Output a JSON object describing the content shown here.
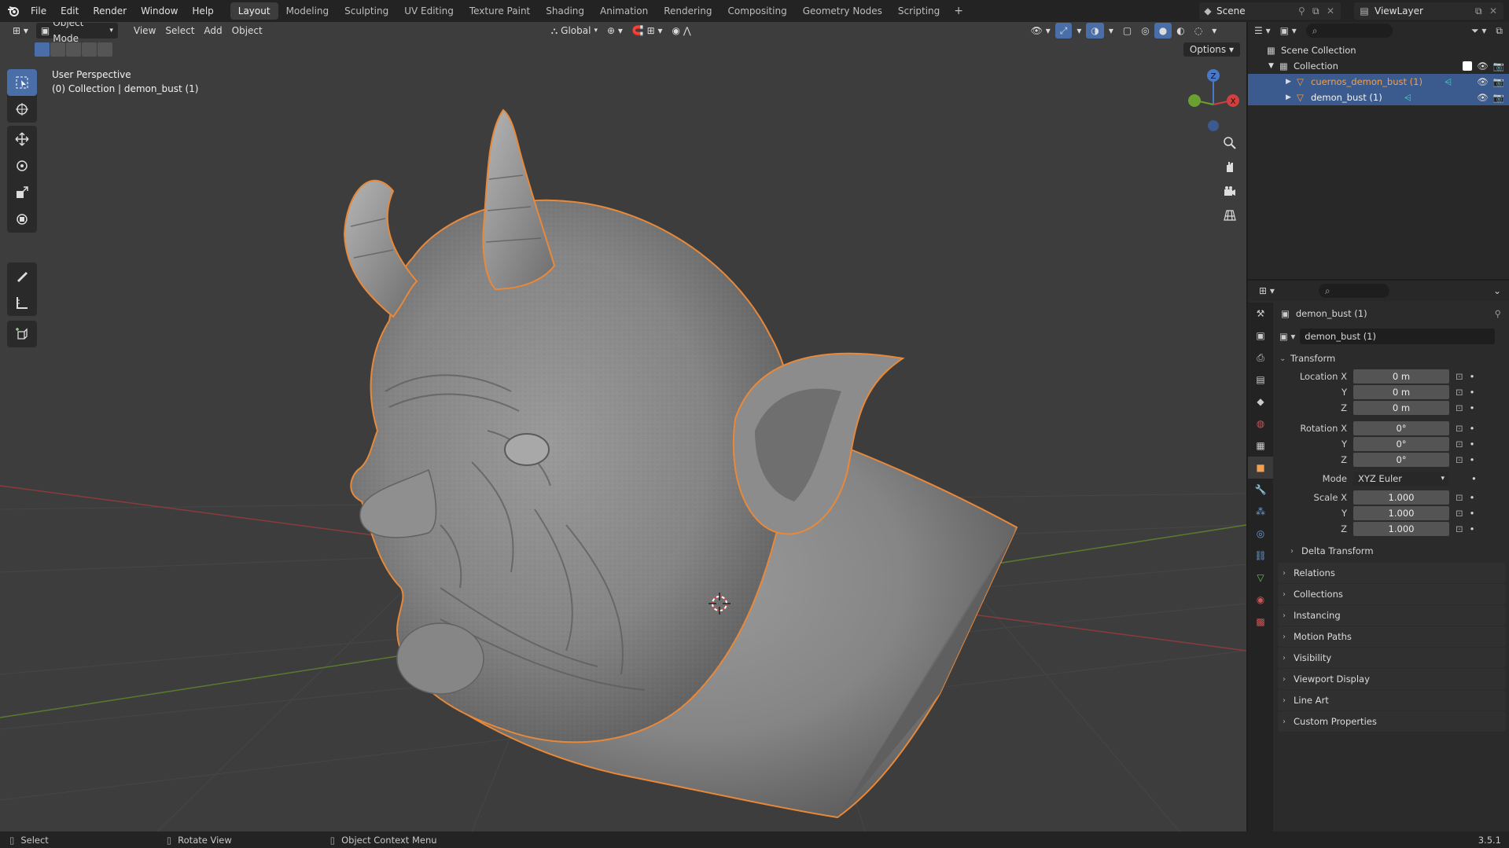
{
  "menubar": {
    "menus": [
      "File",
      "Edit",
      "Render",
      "Window",
      "Help"
    ],
    "workspaces": [
      "Layout",
      "Modeling",
      "Sculpting",
      "UV Editing",
      "Texture Paint",
      "Shading",
      "Animation",
      "Rendering",
      "Compositing",
      "Geometry Nodes",
      "Scripting"
    ],
    "active_workspace": "Layout",
    "scene": "Scene",
    "view_layer": "ViewLayer"
  },
  "viewport": {
    "mode": "Object Mode",
    "menus": [
      "View",
      "Select",
      "Add",
      "Object"
    ],
    "orientation": "Global",
    "options_label": "Options",
    "info_line1": "User Perspective",
    "info_line2": "(0) Collection | demon_bust (1)",
    "gizmo_z": "Z",
    "gizmo_x": "X"
  },
  "outliner": {
    "root": "Scene Collection",
    "collection": "Collection",
    "items": [
      "cuernos_demon_bust (1)",
      "demon_bust (1)"
    ]
  },
  "properties": {
    "object_name": "demon_bust (1)",
    "data_name": "demon_bust (1)",
    "transform_label": "Transform",
    "location": {
      "label": "Location X",
      "x": "0 m",
      "y": "0 m",
      "z": "0 m"
    },
    "rotation": {
      "label": "Rotation X",
      "x": "0°",
      "y": "0°",
      "z": "0°"
    },
    "mode_label": "Mode",
    "mode_value": "XYZ Euler",
    "scale": {
      "label": "Scale X",
      "x": "1.000",
      "y": "1.000",
      "z": "1.000"
    },
    "axis_y": "Y",
    "axis_z": "Z",
    "delta_transform": "Delta Transform",
    "panels": [
      "Relations",
      "Collections",
      "Instancing",
      "Motion Paths",
      "Visibility",
      "Viewport Display",
      "Line Art",
      "Custom Properties"
    ]
  },
  "statusbar": {
    "select": "Select",
    "rotate": "Rotate View",
    "context": "Object Context Menu",
    "version": "3.5.1"
  },
  "colors": {
    "accent": "#4a6fa8",
    "selection_outline": "#e8893a",
    "viewport_bg": "#3d3d3d"
  }
}
